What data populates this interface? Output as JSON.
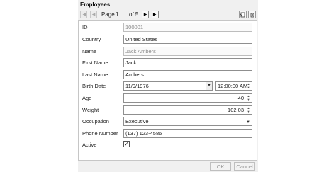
{
  "window": {
    "title": "Employees"
  },
  "navigator": {
    "page_label": "Page",
    "current_page": "1",
    "of_label": "of 5"
  },
  "form": {
    "id": {
      "label": "ID",
      "value": "100001"
    },
    "country": {
      "label": "Country",
      "value": "United States"
    },
    "name": {
      "label": "Name",
      "value": "Jack Ambers"
    },
    "first_name": {
      "label": "First Name",
      "value": "Jack"
    },
    "last_name": {
      "label": "Last Name",
      "value": "Ambers"
    },
    "birth_date": {
      "label": "Birth Date",
      "date": "11/9/1976",
      "time": "12:00:00 AM"
    },
    "age": {
      "label": "Age",
      "value": "40"
    },
    "weight": {
      "label": "Weight",
      "value": "102.03"
    },
    "occupation": {
      "label": "Occupation",
      "value": "Executive"
    },
    "phone": {
      "label": "Phone Number",
      "value": "(137) 123-4586"
    },
    "active": {
      "label": "Active",
      "checked": "✓"
    }
  },
  "buttons": {
    "ok": "OK",
    "cancel": "Cancel"
  }
}
